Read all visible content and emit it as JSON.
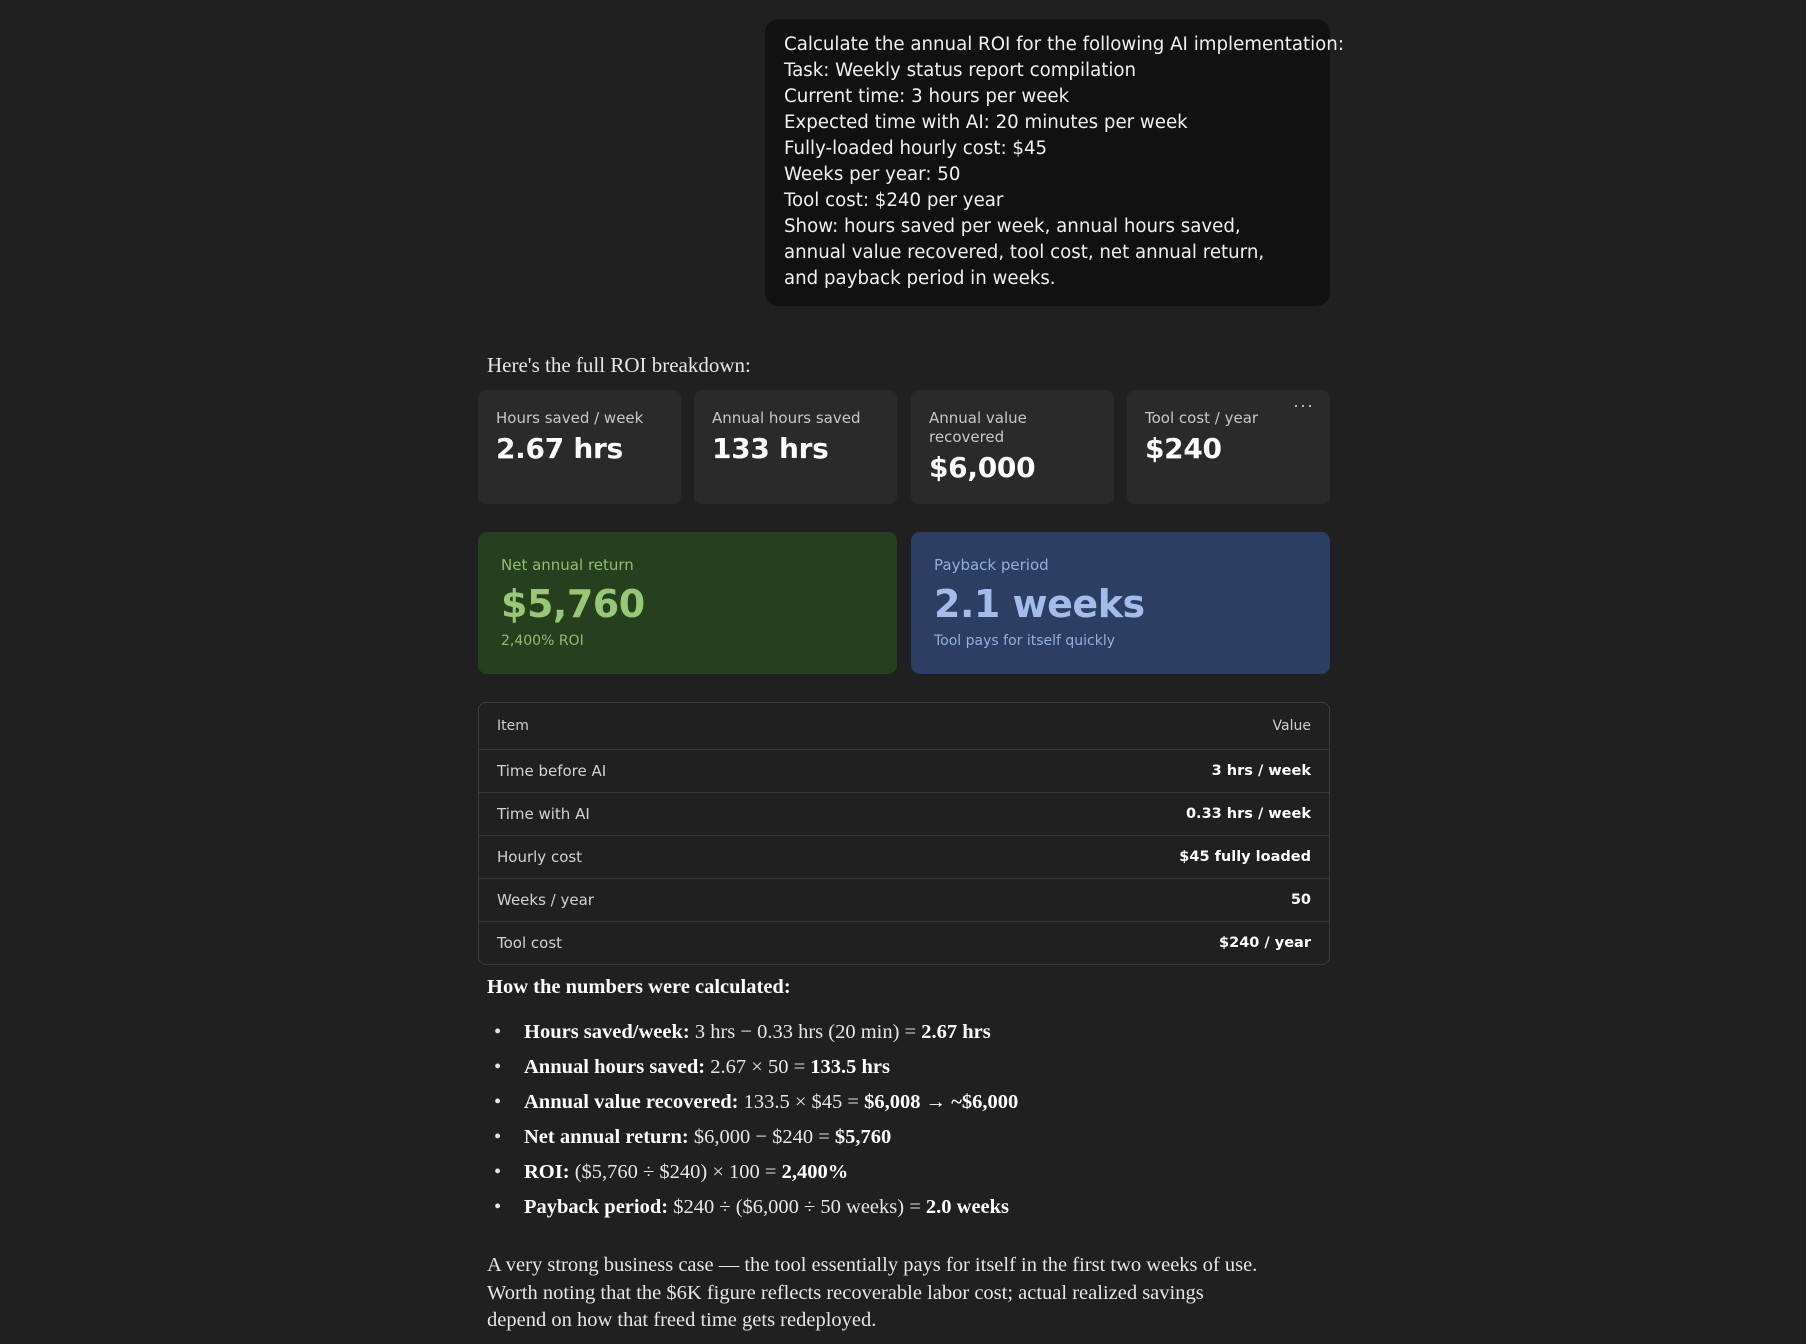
{
  "user_message": {
    "lines": [
      "Calculate the annual ROI for the following AI implementation:",
      "Task: Weekly status report compilation",
      "Current time: 3 hours per week",
      "Expected time with AI: 20 minutes per week",
      "Fully-loaded hourly cost: $45",
      "Weeks per year: 50",
      "Tool cost: $240 per year",
      "Show: hours saved per week, annual hours saved,",
      "annual value recovered, tool cost, net annual return,",
      "and payback period in weeks."
    ]
  },
  "response": {
    "intro": "Here's the full ROI breakdown:",
    "stats": [
      {
        "label": "Hours saved / week",
        "value": "2.67 hrs"
      },
      {
        "label": "Annual hours saved",
        "value": "133 hrs"
      },
      {
        "label": "Annual value recovered",
        "value": "$6,000"
      },
      {
        "label": "Tool cost / year",
        "value": "$240"
      }
    ],
    "more_icon": "ellipsis-icon",
    "highlights": {
      "net": {
        "label": "Net annual return",
        "value": "$5,760",
        "sub": "2,400% ROI"
      },
      "payback": {
        "label": "Payback period",
        "value": "2.1 weeks",
        "sub": "Tool pays for itself quickly"
      }
    },
    "table": {
      "headers": [
        "Item",
        "Value"
      ],
      "rows": [
        [
          "Time before AI",
          "3 hrs / week"
        ],
        [
          "Time with AI",
          "0.33 hrs / week"
        ],
        [
          "Hourly cost",
          "$45 fully loaded"
        ],
        [
          "Weeks / year",
          "50"
        ],
        [
          "Tool cost",
          "$240 / year"
        ]
      ]
    },
    "calc_heading": "How the numbers were calculated:",
    "calc_items": [
      {
        "label": "Hours saved/week:",
        "expr": " 3 hrs − 0.33 hrs (20 min) = ",
        "result": "2.67 hrs"
      },
      {
        "label": "Annual hours saved:",
        "expr": " 2.67 × 50 = ",
        "result": "133.5 hrs"
      },
      {
        "label": "Annual value recovered:",
        "expr": " 133.5 × $45 = ",
        "result": "$6,008 → ~$6,000"
      },
      {
        "label": "Net annual return:",
        "expr": " $6,000 − $240 = ",
        "result": "$5,760"
      },
      {
        "label": "ROI:",
        "expr": " ($5,760 ÷ $240) × 100 = ",
        "result": "2,400%"
      },
      {
        "label": "Payback period:",
        "expr": " $240 ÷ ($6,000 ÷ 50 weeks) = ",
        "result": "2.0 weeks"
      }
    ],
    "closing_lines": [
      "A very strong business case — the tool essentially pays for itself in the first two weeks of use.",
      "Worth noting that the $6K figure reflects recoverable labor cost; actual realized savings",
      "depend on how that freed time gets redeployed."
    ],
    "colors": {
      "background": "#202020",
      "user_bubble": "#111111",
      "net_card": "#263f1e",
      "net_text": "#96c878",
      "payback_card": "#2c3f62",
      "payback_text": "#a3bdeb"
    }
  }
}
